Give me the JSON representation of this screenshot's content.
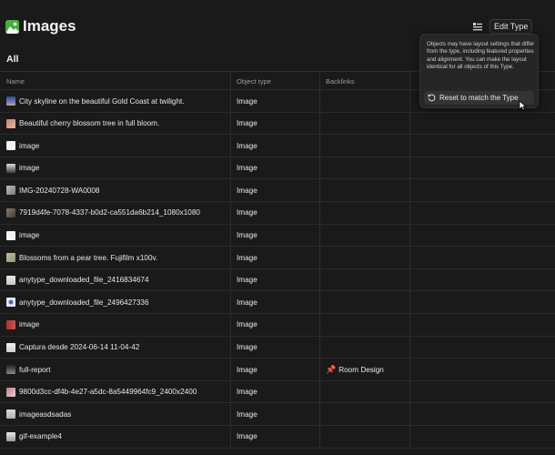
{
  "page": {
    "title": "Images",
    "section": "All"
  },
  "header": {
    "edit_type_label": "Edit Type",
    "title_icon": "image-icon",
    "layout_icon": "layout-list-icon"
  },
  "table": {
    "columns": {
      "name": "Name",
      "type": "Object type",
      "backlinks": "Backlinks"
    },
    "rows": [
      {
        "name": "City skyline on the beautiful Gold Coast at twilight.",
        "type": "Image",
        "backlink": ""
      },
      {
        "name": "Beautiful cherry blossom tree in full bloom.",
        "type": "Image",
        "backlink": ""
      },
      {
        "name": "image",
        "type": "Image",
        "backlink": ""
      },
      {
        "name": "image",
        "type": "Image",
        "backlink": ""
      },
      {
        "name": "IMG-20240728-WA0008",
        "type": "Image",
        "backlink": ""
      },
      {
        "name": "7919d4fe-7078-4337-b0d2-ca551da6b214_1080x1080",
        "type": "Image",
        "backlink": ""
      },
      {
        "name": "image",
        "type": "Image",
        "backlink": ""
      },
      {
        "name": "Blossoms from a pear tree. Fujifilm x100v.",
        "type": "Image",
        "backlink": ""
      },
      {
        "name": "anytype_downloaded_file_2416834674",
        "type": "Image",
        "backlink": ""
      },
      {
        "name": "anytype_downloaded_file_2496427336",
        "type": "Image",
        "backlink": ""
      },
      {
        "name": "image",
        "type": "Image",
        "backlink": ""
      },
      {
        "name": "Captura desde 2024-06-14 11-04-42",
        "type": "Image",
        "backlink": ""
      },
      {
        "name": "full-report",
        "type": "Image",
        "backlink": "Room Design"
      },
      {
        "name": "9800d3cc-df4b-4e27-a5dc-8a5449964fc9_2400x2400",
        "type": "Image",
        "backlink": ""
      },
      {
        "name": "imageasdsadas",
        "type": "Image",
        "backlink": ""
      },
      {
        "name": "gif-example4",
        "type": "Image",
        "backlink": ""
      }
    ]
  },
  "popup": {
    "text": "Objects may have layout settings that differ from the type, including featured properties and alignment. You can make the layout identical for all objects of this Type.",
    "reset_label": "Reset to match the Type",
    "reset_icon": "undo-icon"
  },
  "colors": {
    "accent": "#3fb338",
    "background": "#1a1a1a"
  }
}
